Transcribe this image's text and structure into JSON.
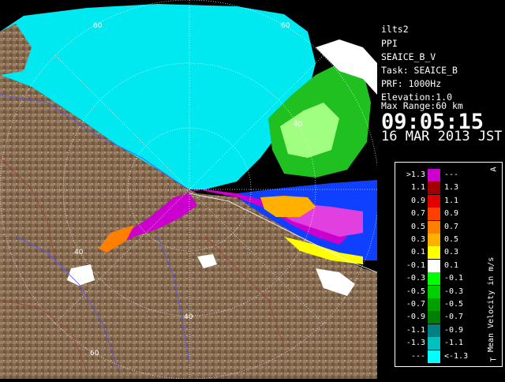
{
  "info": {
    "site": "ilts2",
    "mode": "PPI",
    "scan": "SEAICE_B_V",
    "task": "Task: SEAICE_B",
    "prf": "PRF: 1000Hz",
    "elevation": "Elevation:1.0",
    "max_range": "Max Range:60 km",
    "time": "09:05:15",
    "date": "16 MAR 2013 JST"
  },
  "legend": {
    "unit": "Mean Velocity in m/s",
    "corner_mark": "A",
    "bottom_mark": "T",
    "rows": [
      {
        "left": ">1.3",
        "right": "---",
        "color": "#cc00cc"
      },
      {
        "left": "1.1",
        "right": "1.3",
        "color": "#a00000"
      },
      {
        "left": "0.9",
        "right": "1.1",
        "color": "#e00000"
      },
      {
        "left": "0.7",
        "right": "0.9",
        "color": "#ff4000"
      },
      {
        "left": "0.5",
        "right": "0.7",
        "color": "#ff8000"
      },
      {
        "left": "0.3",
        "right": "0.5",
        "color": "#ffb000"
      },
      {
        "left": "0.1",
        "right": "0.3",
        "color": "#ffff00"
      },
      {
        "left": "-0.1",
        "right": "0.1",
        "color": "#ffffff"
      },
      {
        "left": "-0.3",
        "right": "-0.1",
        "color": "#00ff00"
      },
      {
        "left": "-0.5",
        "right": "-0.3",
        "color": "#00d000"
      },
      {
        "left": "-0.7",
        "right": "-0.5",
        "color": "#00a000"
      },
      {
        "left": "-0.9",
        "right": "-0.7",
        "color": "#008000"
      },
      {
        "left": "-1.1",
        "right": "-0.9",
        "color": "#008080"
      },
      {
        "left": "-1.3",
        "right": "-1.1",
        "color": "#00c0c0"
      },
      {
        "left": "---",
        "right": "<-1.3",
        "color": "#00ffff"
      }
    ]
  },
  "map": {
    "ring_labels": [
      "60",
      "60",
      "40",
      "40",
      "40",
      "60"
    ],
    "colors": {
      "sea": "#00e8f0",
      "land": "#8a7055",
      "ocean_blue": "#1040ff",
      "magenta": "#cc00cc",
      "green": "#20d020"
    }
  }
}
